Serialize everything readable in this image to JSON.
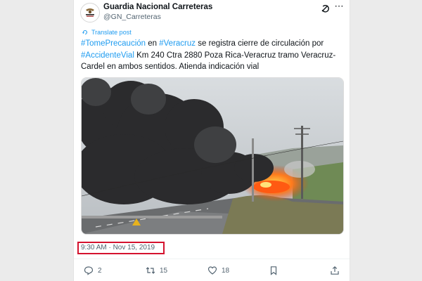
{
  "account": {
    "name": "Guardia Nacional Carreteras",
    "handle": "@GN_Carreteras",
    "avatar_label": "GUARDIA NACIONAL"
  },
  "icons": {
    "grok": "grok-icon",
    "more": "more-icon",
    "translate": "translate-icon",
    "reply": "reply-icon",
    "retweet": "retweet-icon",
    "like": "like-icon",
    "bookmark": "bookmark-icon",
    "share": "share-icon"
  },
  "translate_label": "Translate post",
  "tweet": {
    "hashtag1": "#TomePrecaución",
    "t1": " en ",
    "hashtag2": "#Veracruz",
    "t2": " se registra cierre de circulación por ",
    "hashtag3": "#AccidenteVial",
    "t3": " Km 240 Ctra 2880 Poza Rica-Veracruz tramo Veracruz-Cardel en ambos sentidos. Atienda indicación vial"
  },
  "media_description": "",
  "timestamp": "9:30 AM · Nov 15, 2019",
  "actions": {
    "replies": "2",
    "reposts": "15",
    "likes": "18"
  },
  "colors": {
    "accent": "#1d9bf0",
    "highlight_box": "#d4122e",
    "text_primary": "#0f1419",
    "text_secondary": "#536471"
  }
}
